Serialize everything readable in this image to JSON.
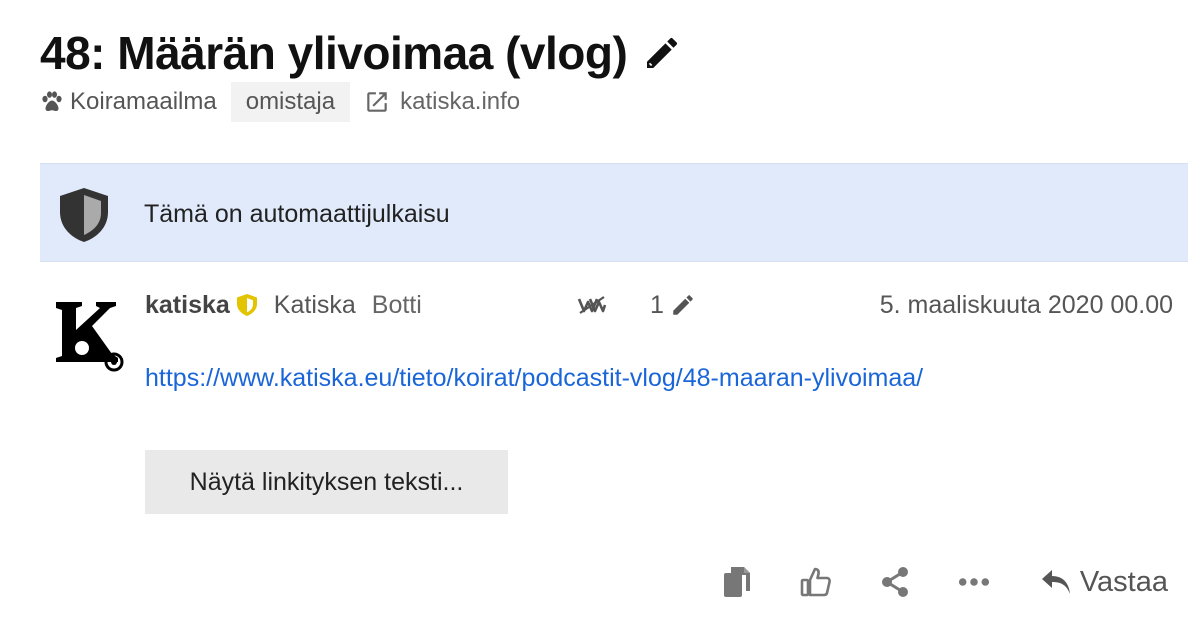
{
  "topic": {
    "title": "48: Määrän ylivoimaa (vlog)",
    "category": "Koiramaailma",
    "tag": "omistaja",
    "external_link": "katiska.info"
  },
  "notice": {
    "text": "Tämä on automaattijulkaisu"
  },
  "post": {
    "username": "katiska",
    "full_name": "Katiska",
    "user_title": "Botti",
    "edit_count": "1",
    "date": "5. maaliskuuta 2020 00.00",
    "link_url": "https://www.katiska.eu/tieto/koirat/podcastit-vlog/48-maaran-ylivoimaa/",
    "expand_button": "Näytä linkityksen teksti...",
    "avatar_letter": "K"
  },
  "actions": {
    "reply_label": "Vastaa"
  },
  "icons": {
    "edit_title": "pencil-icon",
    "category": "paw-icon",
    "external": "external-link-icon",
    "notice": "shield-icon",
    "moderator": "shield-badge-icon",
    "wiki": "wiki-icon",
    "edits": "pencil-icon",
    "copy": "copy-icon",
    "like": "thumbs-up-icon",
    "share": "share-icon",
    "more": "ellipsis-icon",
    "reply": "reply-icon"
  },
  "colors": {
    "notice_bg": "#e0eafa",
    "link": "#1a66d9",
    "moderator_badge": "#e3c400",
    "tag_bg": "#f2f2f2",
    "button_bg": "#e9e9e9"
  }
}
